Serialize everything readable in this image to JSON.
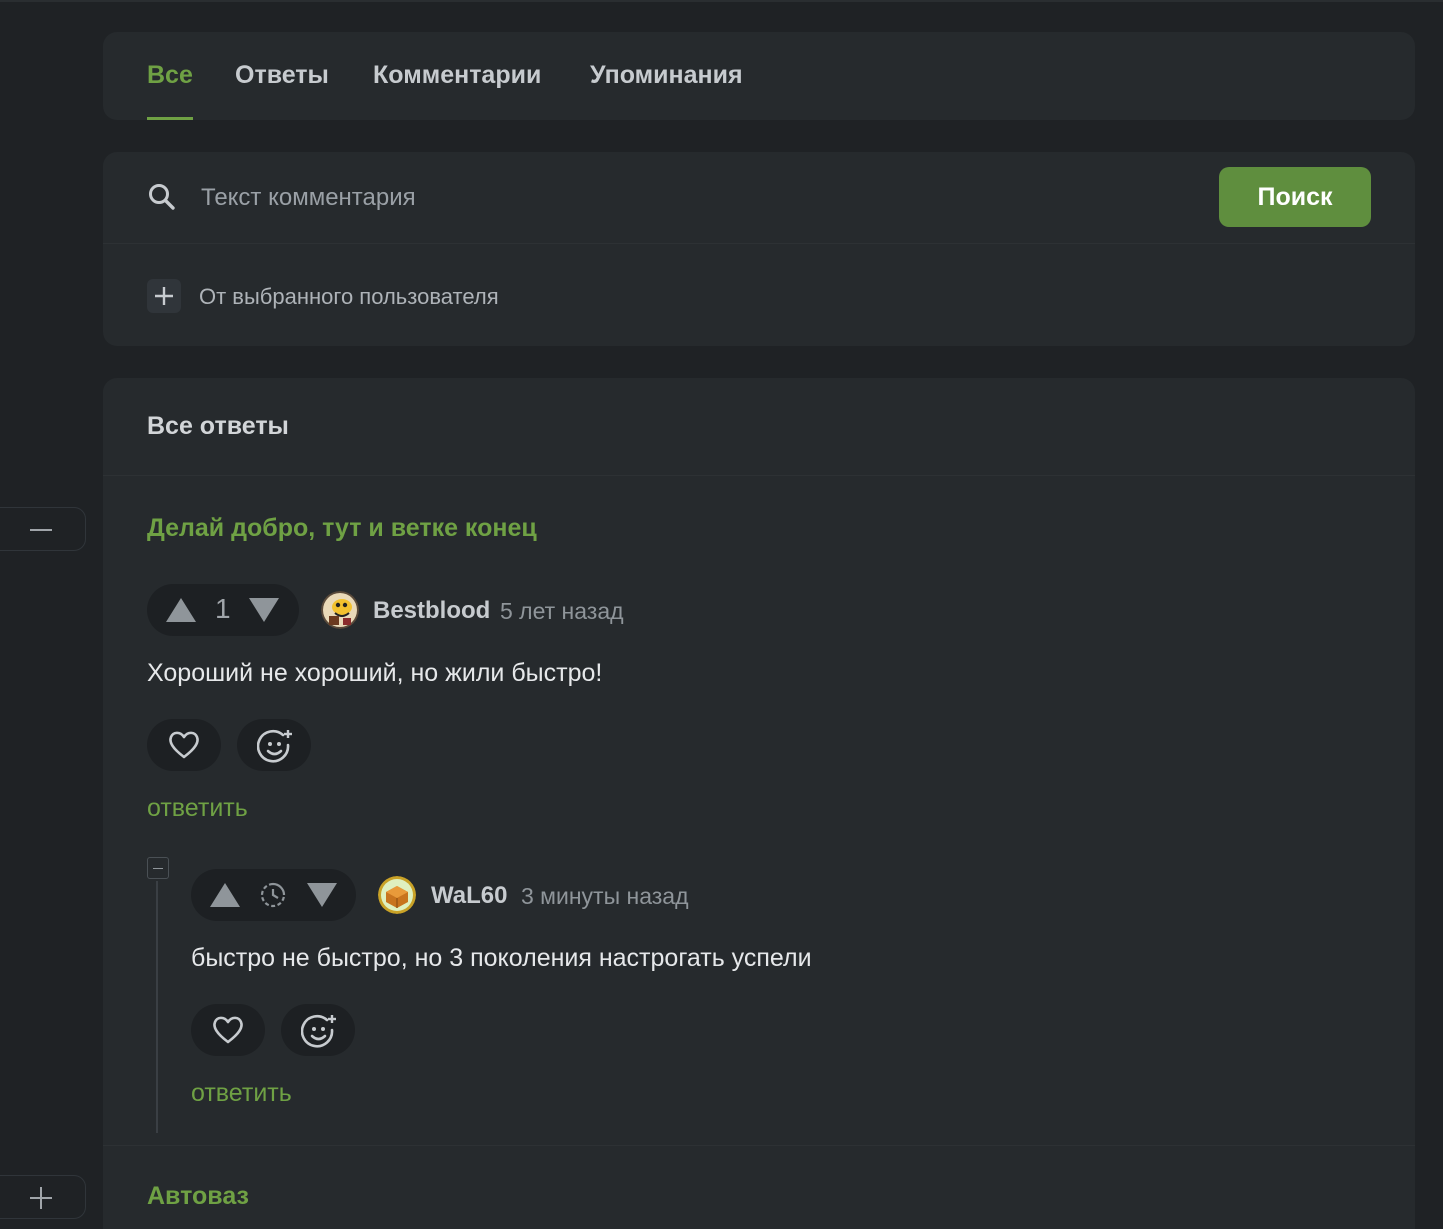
{
  "tabs": [
    {
      "label": "Все",
      "active": true
    },
    {
      "label": "Ответы",
      "active": false
    },
    {
      "label": "Комментарии",
      "active": false
    },
    {
      "label": "Упоминания",
      "active": false
    }
  ],
  "search": {
    "placeholder": "Текст комментария",
    "button_label": "Поиск",
    "filter_label": "От выбранного пользователя"
  },
  "section": {
    "title": "Все ответы"
  },
  "threads": [
    {
      "title": "Делай добро, тут и ветке конец",
      "comment": {
        "score": "1",
        "username": "Bestblood",
        "time": "5 лет назад",
        "text": "Хороший не хороший, но жили быстро!",
        "reply_label": "ответить"
      },
      "reply": {
        "score_icon": "clock-icon",
        "username": "WaL60",
        "time": "3 минуты назад",
        "text": "быстро не быстро, но 3 поколения настрогать успели",
        "reply_label": "ответить"
      }
    },
    {
      "title": "Автоваз"
    }
  ],
  "colors": {
    "accent": "#6fa144",
    "button": "#5f8e3e",
    "background": "#1f2225",
    "card": "#262a2d"
  }
}
